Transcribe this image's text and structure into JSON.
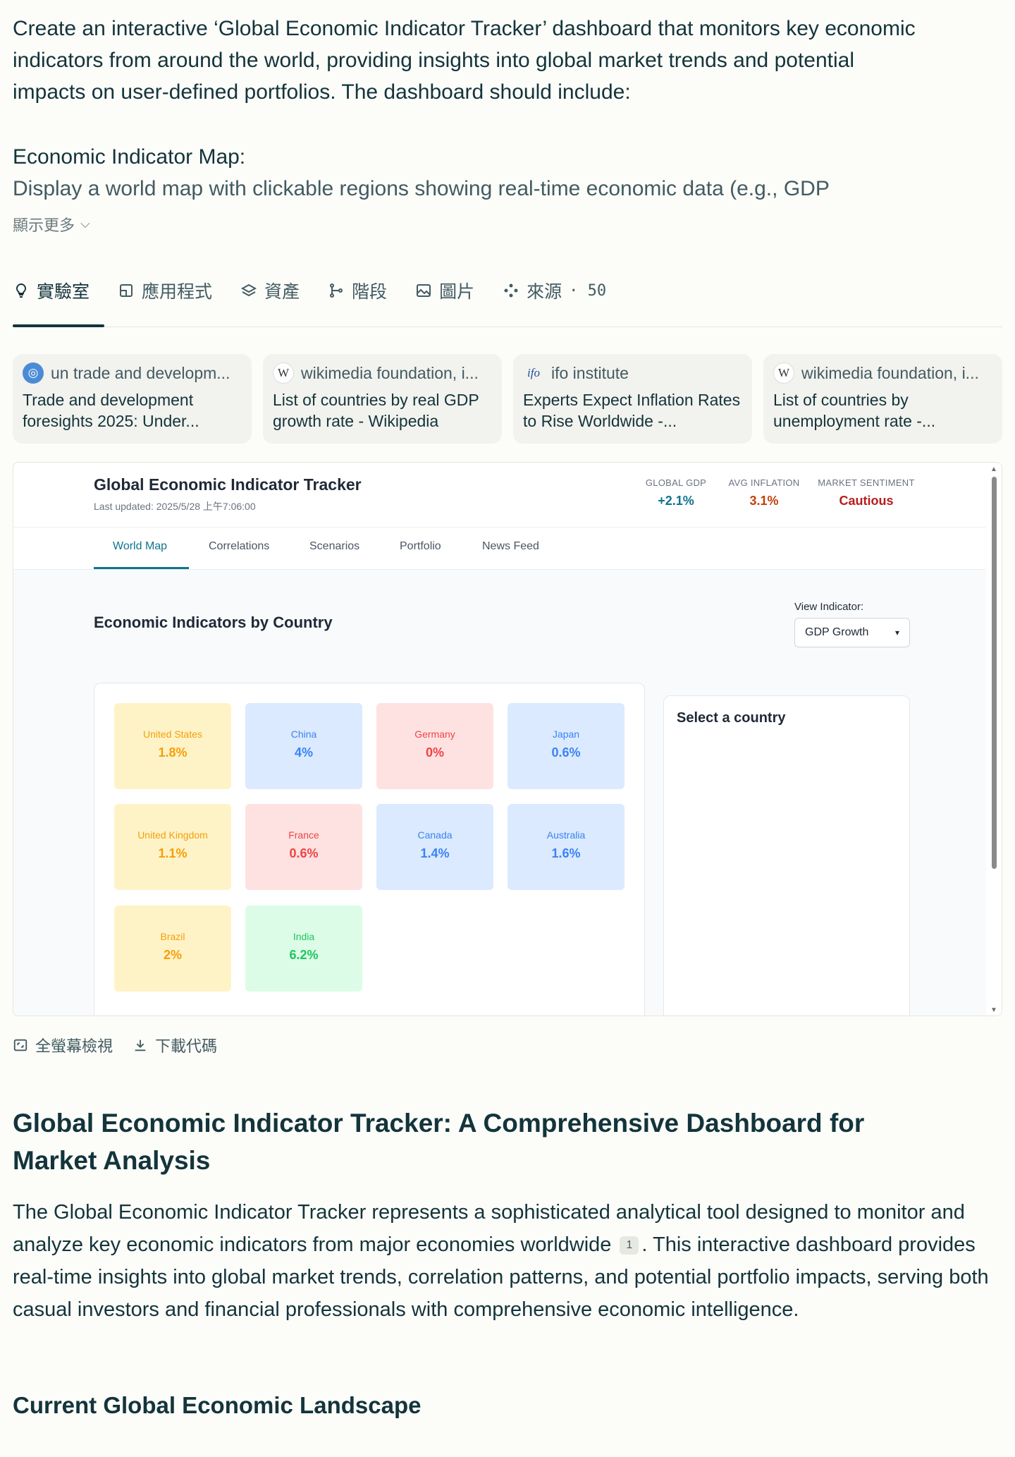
{
  "prompt": {
    "text": "Create an interactive ‘Global Economic Indicator Tracker’ dashboard that monitors key economic indicators from around the world, providing insights into global market trends and potential impacts on user-defined portfolios. The dashboard should include:",
    "heading": "Economic Indicator Map:",
    "more_text": "Display a world map with clickable regions showing real-time economic data (e.g., GDP",
    "show_more": "顯示更多"
  },
  "tabs": [
    {
      "label": "實驗室",
      "icon": "lightbulb-icon"
    },
    {
      "label": "應用程式",
      "icon": "app-icon"
    },
    {
      "label": "資產",
      "icon": "layers-icon"
    },
    {
      "label": "階段",
      "icon": "branch-icon"
    },
    {
      "label": "圖片",
      "icon": "image-icon"
    },
    {
      "label": "來源",
      "icon": "sources-icon",
      "count": "· 50"
    }
  ],
  "sources": [
    {
      "site": "un trade and developm...",
      "title": "Trade and development foresights 2025: Under..."
    },
    {
      "site": "wikimedia foundation, i...",
      "title": "List of countries by real GDP growth rate - Wikipedia"
    },
    {
      "site": "ifo institute",
      "title": "Experts Expect Inflation Rates to Rise Worldwide -..."
    },
    {
      "site": "wikimedia foundation, i...",
      "title": "List of countries by unemployment rate -..."
    }
  ],
  "app": {
    "title": "Global Economic Indicator Tracker",
    "updated": "Last updated: 2025/5/28 上午7:06:00",
    "stats": [
      {
        "label": "GLOBAL GDP",
        "value": "+2.1%",
        "color": "#0e7490"
      },
      {
        "label": "AVG INFLATION",
        "value": "3.1%",
        "color": "#c2410c"
      },
      {
        "label": "MARKET SENTIMENT",
        "value": "Cautious",
        "color": "#b91c1c"
      }
    ],
    "nav": [
      "World Map",
      "Correlations",
      "Scenarios",
      "Portfolio",
      "News Feed"
    ],
    "section_title": "Economic Indicators by Country",
    "view_label": "View Indicator:",
    "view_value": "GDP Growth",
    "countries": [
      {
        "name": "United States",
        "value": "1.8%",
        "tone": "yellow"
      },
      {
        "name": "China",
        "value": "4%",
        "tone": "blue"
      },
      {
        "name": "Germany",
        "value": "0%",
        "tone": "red"
      },
      {
        "name": "Japan",
        "value": "0.6%",
        "tone": "blue"
      },
      {
        "name": "United Kingdom",
        "value": "1.1%",
        "tone": "yellow"
      },
      {
        "name": "France",
        "value": "0.6%",
        "tone": "red"
      },
      {
        "name": "Canada",
        "value": "1.4%",
        "tone": "blue"
      },
      {
        "name": "Australia",
        "value": "1.6%",
        "tone": "blue"
      },
      {
        "name": "Brazil",
        "value": "2%",
        "tone": "yellow"
      },
      {
        "name": "India",
        "value": "6.2%",
        "tone": "green"
      }
    ],
    "detail_title": "Select a country"
  },
  "actions": {
    "fullscreen": "全螢幕檢視",
    "download": "下載代碼"
  },
  "answer": {
    "title": "Global Economic Indicator Tracker: A Comprehensive Dashboard for Market Analysis",
    "body_part1": "The Global Economic Indicator Tracker represents a sophisticated analytical tool designed to monitor and analyze key economic indicators from major economies worldwide",
    "citation": "1",
    "body_part2": ". This interactive dashboard provides real-time insights into global market trends, correlation patterns, and potential portfolio impacts, serving both casual investors and financial professionals with comprehensive economic intelligence.",
    "subheading": "Current Global Economic Landscape"
  }
}
